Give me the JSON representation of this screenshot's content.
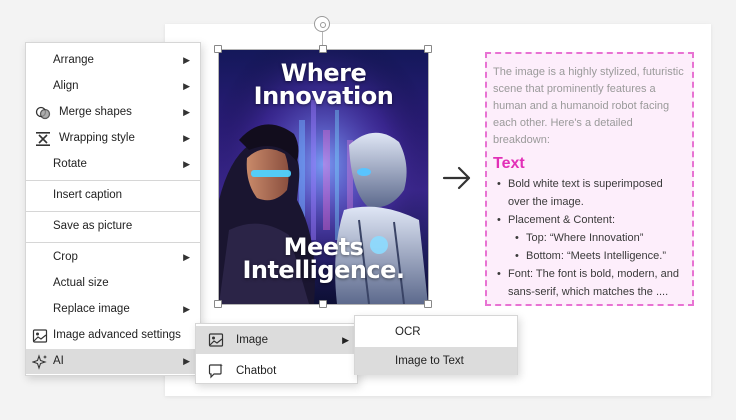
{
  "poster": {
    "title_top": "Where Innovation",
    "title_bottom": "Meets Intelligence."
  },
  "result": {
    "intro": "The image is a highly stylized, futuristic scene that prominently features a human and a humanoid robot facing each other. Here's a detailed breakdown:",
    "heading": "Text",
    "bullets": [
      "Bold white text is superimposed over the image.",
      "Placement & Content:",
      "Top: “Where Innovation”",
      "Bottom: “Meets Intelligence.”",
      "Font: The font is bold, modern, and sans-serif, which matches the ...."
    ]
  },
  "context_menu": {
    "items": [
      {
        "label": "Arrange"
      },
      {
        "label": "Align"
      },
      {
        "label": "Merge shapes"
      },
      {
        "label": "Wrapping style"
      },
      {
        "label": "Rotate"
      },
      {
        "label": "Insert caption"
      },
      {
        "label": "Save as picture"
      },
      {
        "label": "Crop"
      },
      {
        "label": "Actual size"
      },
      {
        "label": "Replace image"
      },
      {
        "label": "Image advanced settings"
      },
      {
        "label": "AI"
      }
    ]
  },
  "ai_submenu": {
    "items": [
      {
        "label": "Image"
      },
      {
        "label": "Chatbot"
      }
    ]
  },
  "image_submenu": {
    "items": [
      {
        "label": "OCR"
      },
      {
        "label": "Image to Text"
      }
    ]
  },
  "colors": {
    "result_border": "#e873d3",
    "result_bg": "#fdeefb",
    "heading": "#e22fb7",
    "menu_highlight": "#dcdcdc"
  }
}
